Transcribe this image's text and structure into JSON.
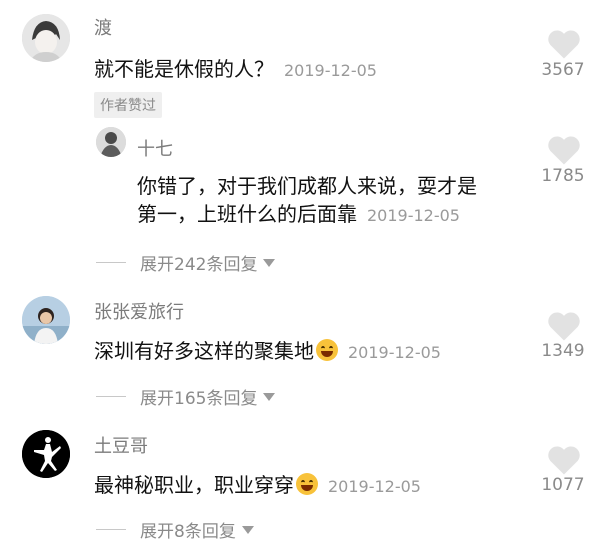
{
  "comments": [
    {
      "username": "渡",
      "text": "就不能是休假的人？",
      "date": "2019-12-05",
      "likes": "3567",
      "tag": "作者赞过",
      "reply": {
        "username": "十七",
        "text_line1": "你错了，对于我们成都人来说，耍才是",
        "text_line2": "第一，上班什么的后面靠",
        "date": "2019-12-05",
        "likes": "1785",
        "expand": "展开242条回复"
      }
    },
    {
      "username": "张张爱旅行",
      "text": "深圳有好多这样的聚集地",
      "date": "2019-12-05",
      "likes": "1349",
      "expand": "展开165条回复"
    },
    {
      "username": "土豆哥",
      "text": "最神秘职业，职业穿穿",
      "date": "2019-12-05",
      "likes": "1077",
      "expand": "展开8条回复"
    }
  ],
  "colors": {
    "heart": "#e2e2e2",
    "meta": "#9a9a9a"
  }
}
